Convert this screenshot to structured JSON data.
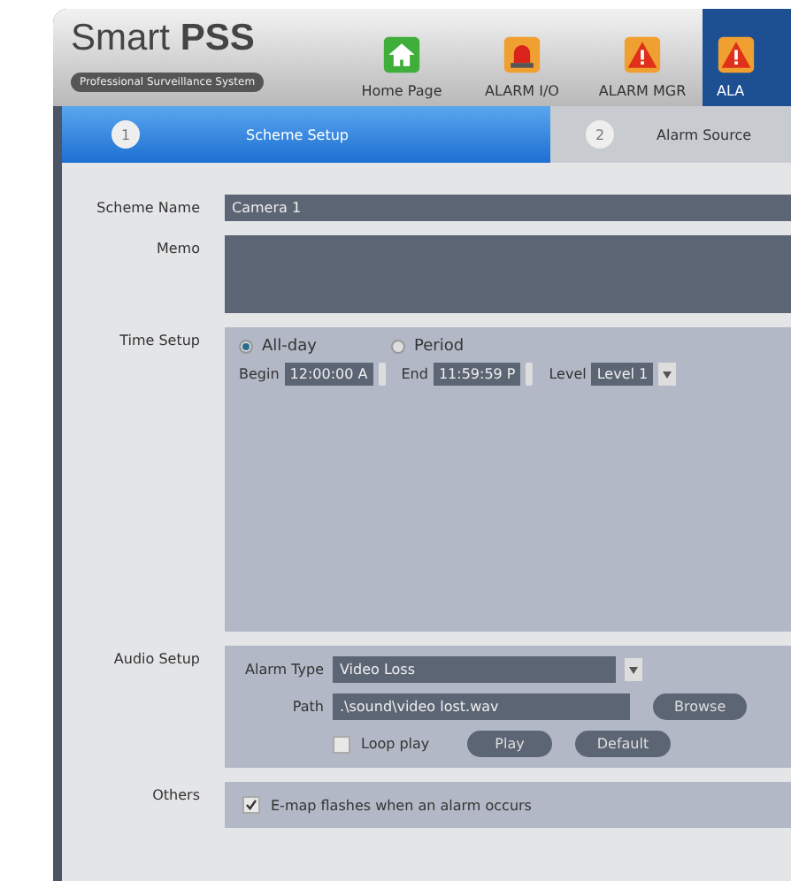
{
  "header": {
    "logo": "Smart",
    "logo_bold": "PSS",
    "tagline": "Professional Surveillance System"
  },
  "nav": [
    {
      "label": "Home Page",
      "kind": "home",
      "selected": false
    },
    {
      "label": "ALARM I/O",
      "kind": "siren",
      "selected": false
    },
    {
      "label": "ALARM MGR",
      "kind": "warning",
      "selected": false
    },
    {
      "label": "ALA",
      "kind": "warning",
      "selected": true
    }
  ],
  "steps": [
    {
      "number": "1",
      "label": "Scheme Setup",
      "selected": true
    },
    {
      "number": "2",
      "label": "Alarm Source",
      "selected": false
    }
  ],
  "scheme_name": {
    "label": "Scheme Name",
    "value": "Camera 1"
  },
  "memo": {
    "label": "Memo"
  },
  "time_setup": {
    "label": "Time Setup",
    "options": [
      {
        "label": "All-day",
        "selected": true
      },
      {
        "label": "Period",
        "selected": false
      }
    ],
    "begin": {
      "label": "Begin",
      "value": "12:00:00 A"
    },
    "end": {
      "label": "End",
      "value": "11:59:59 P"
    },
    "level": {
      "label": "Level",
      "value": "Level 1"
    }
  },
  "audio_setup": {
    "label": "Audio Setup",
    "alarm_type": {
      "label": "Alarm Type",
      "value": "Video Loss"
    },
    "path": {
      "label": "Path",
      "value": ".\\sound\\video lost.wav"
    },
    "browse": "Browse",
    "loop_play": {
      "label": "Loop play",
      "checked": false
    },
    "play": "Play",
    "default": "Default"
  },
  "others": {
    "label": "Others",
    "emap": {
      "label": "E-map flashes when an alarm occurs",
      "checked": true
    }
  }
}
